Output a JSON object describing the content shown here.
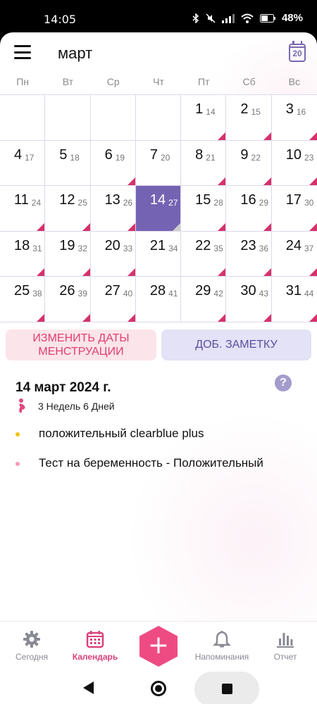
{
  "status_bar": {
    "time": "14:05",
    "battery": "48%",
    "icons": [
      "bluetooth-icon",
      "mute-icon",
      "signal-icon",
      "wifi-icon",
      "battery-icon"
    ]
  },
  "header": {
    "month": "март",
    "today_icon_number": "20"
  },
  "weekdays": [
    "Пн",
    "Вт",
    "Ср",
    "Чт",
    "Пт",
    "Сб",
    "Вс"
  ],
  "calendar": {
    "cells": [
      {
        "day": "",
        "sub": "",
        "mark": false
      },
      {
        "day": "",
        "sub": "",
        "mark": false
      },
      {
        "day": "",
        "sub": "",
        "mark": false
      },
      {
        "day": "",
        "sub": "",
        "mark": false
      },
      {
        "day": "1",
        "sub": "14",
        "mark": true
      },
      {
        "day": "2",
        "sub": "15",
        "mark": true
      },
      {
        "day": "3",
        "sub": "16",
        "mark": true
      },
      {
        "day": "4",
        "sub": "17",
        "mark": false
      },
      {
        "day": "5",
        "sub": "18",
        "mark": false
      },
      {
        "day": "6",
        "sub": "19",
        "mark": true
      },
      {
        "day": "7",
        "sub": "20",
        "mark": false
      },
      {
        "day": "8",
        "sub": "21",
        "mark": true
      },
      {
        "day": "9",
        "sub": "22",
        "mark": true
      },
      {
        "day": "10",
        "sub": "23",
        "mark": true
      },
      {
        "day": "11",
        "sub": "24",
        "mark": true
      },
      {
        "day": "12",
        "sub": "25",
        "mark": true
      },
      {
        "day": "13",
        "sub": "26",
        "mark": true
      },
      {
        "day": "14",
        "sub": "27",
        "mark": true,
        "today": true
      },
      {
        "day": "15",
        "sub": "28",
        "mark": true
      },
      {
        "day": "16",
        "sub": "29",
        "mark": true
      },
      {
        "day": "17",
        "sub": "30",
        "mark": true
      },
      {
        "day": "18",
        "sub": "31",
        "mark": true
      },
      {
        "day": "19",
        "sub": "32",
        "mark": true
      },
      {
        "day": "20",
        "sub": "33",
        "mark": true
      },
      {
        "day": "21",
        "sub": "34",
        "mark": false
      },
      {
        "day": "22",
        "sub": "35",
        "mark": true
      },
      {
        "day": "23",
        "sub": "36",
        "mark": true
      },
      {
        "day": "24",
        "sub": "37",
        "mark": true
      },
      {
        "day": "25",
        "sub": "38",
        "mark": true
      },
      {
        "day": "26",
        "sub": "39",
        "mark": true
      },
      {
        "day": "27",
        "sub": "40",
        "mark": true
      },
      {
        "day": "28",
        "sub": "41",
        "mark": false
      },
      {
        "day": "29",
        "sub": "42",
        "mark": true
      },
      {
        "day": "30",
        "sub": "43",
        "mark": true
      },
      {
        "day": "31",
        "sub": "44",
        "mark": true
      }
    ]
  },
  "actions": {
    "change_period_line1": "ИЗМЕНИТЬ ДАТЫ",
    "change_period_line2": "МЕНСТРУАЦИИ",
    "add_note": "ДОБ. ЗАМЕТКУ"
  },
  "details": {
    "date": "14 март 2024 г.",
    "pregnancy": "3 Недель 6 Дней",
    "help": "?",
    "notes": [
      {
        "text": "положительный clearblue plus",
        "color": "#f2c200"
      },
      {
        "text": "Тест на беременность - Положительный",
        "color": "#f49ab5"
      }
    ]
  },
  "bottom_nav": {
    "today": "Сегодня",
    "calendar": "Календарь",
    "add": "+",
    "reminders": "Напоминания",
    "report": "Отчет"
  },
  "colors": {
    "accent": "#7463b3",
    "period": "#d6316a",
    "pink_button_bg": "#fbe4ea",
    "purple_button_bg": "#e3e2f6"
  }
}
